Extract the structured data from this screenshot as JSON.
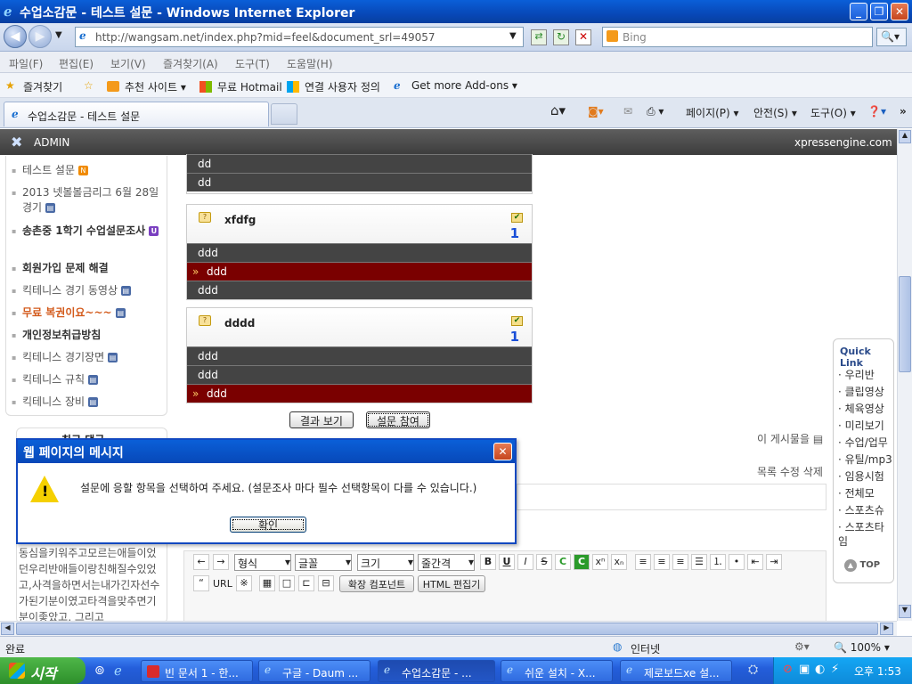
{
  "window": {
    "title": "수업소감문 - 테스트 설문 - Windows Internet Explorer"
  },
  "address": {
    "url": "http://wangsam.net/index.php?mid=feel&document_srl=49057",
    "search_placeholder": "Bing"
  },
  "menu": [
    "파일(F)",
    "편집(E)",
    "보기(V)",
    "즐겨찾기(A)",
    "도구(T)",
    "도움말(H)"
  ],
  "favorites": {
    "label": "즐겨찾기",
    "items": [
      "추천 사이트 ▾",
      "무료 Hotmail",
      "연결 사용자 정의",
      "Get more Add-ons ▾"
    ]
  },
  "tab": {
    "title": "수업소감문 - 테스트 설문"
  },
  "commandbar": {
    "page": "페이지(P) ▾",
    "safety": "안전(S) ▾",
    "tools": "도구(O) ▾"
  },
  "admin": {
    "label": "ADMIN",
    "brand": "xpressengine.com"
  },
  "sidebar": {
    "items": [
      {
        "label": "테스트 설문",
        "badge": "N"
      },
      {
        "label": "2013 넷볼볼금리그 6월 28일 경기",
        "badge": "▤"
      },
      {
        "label": "송촌중 1학기 수업설문조사",
        "badge": "U"
      },
      {
        "label": "회원가입 문제 해결",
        "badge": ""
      },
      {
        "label": "킥테니스 경기 동영상",
        "badge": "▤"
      },
      {
        "label": "무료 복권이요~~~",
        "badge": "▤"
      },
      {
        "label": "개인정보취급방침",
        "badge": ""
      },
      {
        "label": "킥테니스 경기장면",
        "badge": "▤"
      },
      {
        "label": "킥테니스 규칙",
        "badge": "▤"
      },
      {
        "label": "킥테니스 장비",
        "badge": "▤"
      }
    ],
    "recent_comments_title": "최근 댓글",
    "comment_text": "동심을키워주고모르는애들이었던우리반애들이랑친해질수있었고,사격을하면서는내가긴자선수가된기분이였고타격을맞추면기분이좋았고, 그리고"
  },
  "poll": {
    "top_rows": [
      "dd",
      "dd"
    ],
    "questions": [
      {
        "title": "xfdfg",
        "count": "1",
        "options": [
          {
            "label": "ddd",
            "selected": false
          },
          {
            "label": "ddd",
            "selected": true
          },
          {
            "label": "ddd",
            "selected": false
          }
        ]
      },
      {
        "title": "dddd",
        "count": "1",
        "options": [
          {
            "label": "ddd",
            "selected": false
          },
          {
            "label": "ddd",
            "selected": false
          },
          {
            "label": "ddd",
            "selected": true
          }
        ]
      }
    ],
    "result_button": "결과 보기",
    "submit_button": "설문 참여"
  },
  "post": {
    "share_text": "이 게시물을",
    "actions": "목록 수정 삭제"
  },
  "quicklink": {
    "title": "Quick Link",
    "items": [
      "우리반",
      "클립영상",
      "체육영상",
      "미리보기",
      "수업/업무",
      "유틸/mp3",
      "임용시험",
      "전체모",
      "스포츠슈",
      "스포츠타임"
    ],
    "top": "TOP"
  },
  "editor": {
    "format": "형식",
    "font": "글꼴",
    "size": "크기",
    "linespacing": "줄간격",
    "url": "URL",
    "ext_component": "확장 컴포넌트",
    "html_edit": "HTML 편집기"
  },
  "dialog": {
    "title": "웹 페이지의 메시지",
    "message": "설문에 응할 항목을 선택하여 주세요. (설문조사 마다 필수 선택항목이 다를 수 있습니다.)",
    "ok": "확인"
  },
  "status": {
    "left": "완료",
    "zone": "인터넷",
    "zoom": "100%"
  },
  "taskbar": {
    "start": "시작",
    "buttons": [
      "빈 문서 1 - 한...",
      "구글 - Daum ...",
      "수업소감문 - ...",
      "쉬운 설치 - X...",
      "제로보드xe 설..."
    ],
    "clock": "오후 1:53"
  }
}
